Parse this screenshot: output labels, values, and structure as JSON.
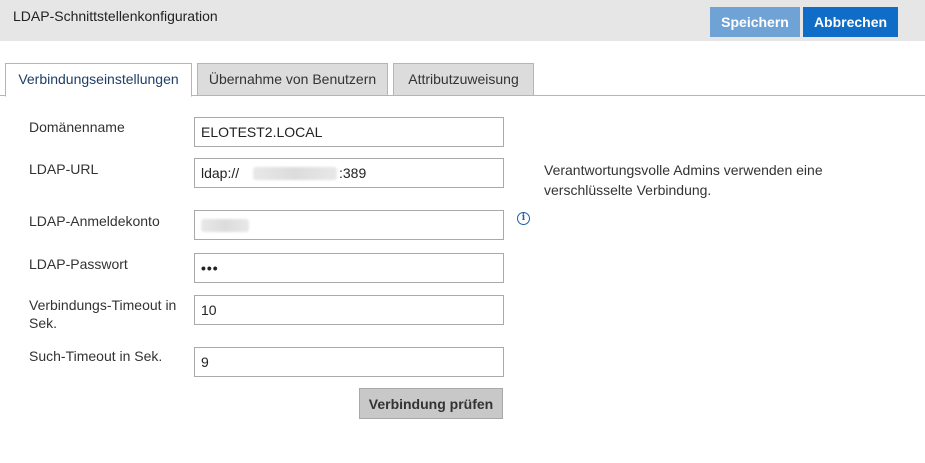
{
  "header": {
    "title": "LDAP-Schnittstellenkonfiguration",
    "save_label": "Speichern",
    "cancel_label": "Abbrechen",
    "save_color": "#6fa3d6",
    "cancel_color": "#0f6cc7"
  },
  "tabs": [
    {
      "label": "Verbindungseinstellungen",
      "active": true
    },
    {
      "label": "Übernahme von Benutzern",
      "active": false
    },
    {
      "label": "Attributzuweisung",
      "active": false
    }
  ],
  "form": {
    "domain": {
      "label": "Domänenname",
      "value": "ELOTEST2.LOCAL"
    },
    "url": {
      "label": "LDAP-URL",
      "prefix": "ldap://",
      "suffix": ":389"
    },
    "account": {
      "label": "LDAP-Anmeldekonto",
      "value": ""
    },
    "password": {
      "label": "LDAP-Passwort",
      "value": "•••"
    },
    "conn_timeout": {
      "label": "Verbindungs-Timeout in Sek.",
      "value": "10"
    },
    "search_timeout": {
      "label": "Such-Timeout in Sek.",
      "value": "9"
    }
  },
  "hint": "Verantwortungsvolle Admins verwenden eine verschlüsselte Verbindung.",
  "info_icon": "info-icon",
  "check_label": "Verbindung prüfen"
}
